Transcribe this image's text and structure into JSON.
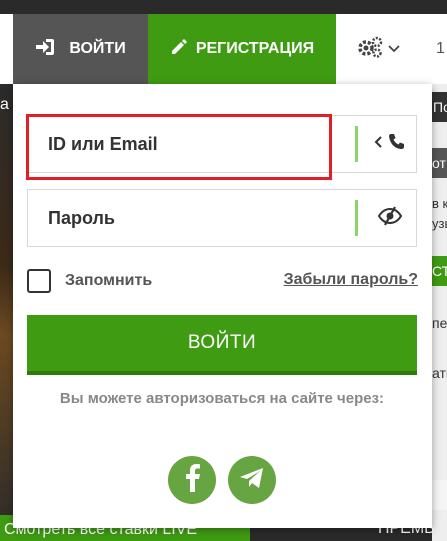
{
  "header": {
    "login_label": "ВОЙТИ",
    "register_label": "РЕГИСТРАЦИЯ",
    "settings_icon": "gears-icon",
    "trailing_text": "1"
  },
  "background": {
    "left_text": "а",
    "live_label": "Смотреть все ставки LIVE",
    "right_texts": [
      "По",
      "от",
      "в к\nузы",
      "СТ",
      "пе",
      "ать"
    ],
    "bottom_right_text": "ПРЕМЬ"
  },
  "login_form": {
    "id_placeholder": "ID или Email",
    "password_placeholder": "Пароль",
    "remember_label": "Запомнить",
    "forgot_label": "Забыли пароль?",
    "submit_label": "ВОЙТИ",
    "social_note": "Вы можете авторизоваться на сайте через:",
    "social": [
      {
        "name": "facebook",
        "icon": "facebook-icon"
      },
      {
        "name": "telegram",
        "icon": "telegram-icon"
      }
    ]
  },
  "colors": {
    "brand_green": "#3f9c12",
    "social_green": "#67a542",
    "highlight_red": "#e01f26",
    "header_dark": "#555555"
  }
}
